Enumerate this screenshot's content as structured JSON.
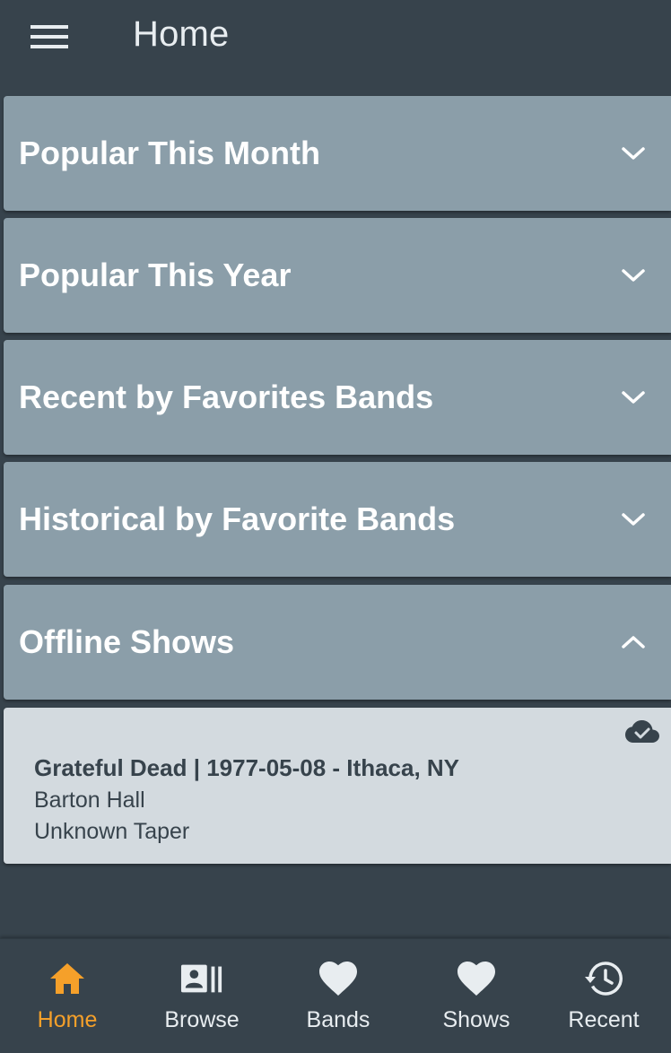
{
  "header": {
    "title": "Home",
    "menu_icon": "hamburger-menu-icon"
  },
  "sections": [
    {
      "label": "Popular This Month",
      "expanded": false
    },
    {
      "label": "Popular This Year",
      "expanded": false
    },
    {
      "label": "Recent by Favorites Bands",
      "expanded": false
    },
    {
      "label": "Historical by Favorite Bands",
      "expanded": false
    },
    {
      "label": "Offline Shows",
      "expanded": true
    }
  ],
  "offline_show": {
    "title": "Grateful Dead | 1977-05-08 - Ithaca, NY",
    "venue": "Barton Hall",
    "taper": "Unknown Taper",
    "status_icon": "cloud-check-icon"
  },
  "bottom_nav": {
    "active": "home",
    "items": [
      {
        "key": "home",
        "label": "Home",
        "icon": "home-icon"
      },
      {
        "key": "browse",
        "label": "Browse",
        "icon": "browse-icon"
      },
      {
        "key": "bands",
        "label": "Bands",
        "icon": "heart-icon"
      },
      {
        "key": "shows",
        "label": "Shows",
        "icon": "heart-icon"
      },
      {
        "key": "recent",
        "label": "Recent",
        "icon": "history-icon"
      }
    ]
  },
  "colors": {
    "background": "#37434c",
    "section": "#8b9ea9",
    "card": "#d3dadf",
    "accent": "#f5a02a",
    "text_light": "#e8edf0",
    "text_dark": "#37434c"
  }
}
